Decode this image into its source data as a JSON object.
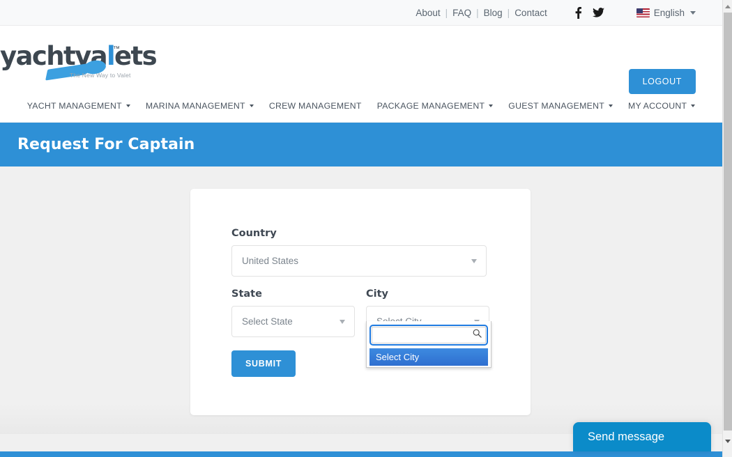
{
  "topbar": {
    "links": [
      {
        "label": "About"
      },
      {
        "label": "FAQ"
      },
      {
        "label": "Blog"
      },
      {
        "label": "Contact"
      }
    ],
    "separator": "|",
    "social": [
      {
        "name": "facebook-icon"
      },
      {
        "name": "twitter-icon"
      }
    ],
    "language": {
      "label": "English",
      "flag": "us-flag-icon"
    }
  },
  "header": {
    "logo": {
      "text_part1": "yacht",
      "text_part2": "va",
      "text_part3": "l",
      "text_part4": "ets",
      "trademark": "™",
      "tagline": "The New Way to Valet"
    },
    "logout_label": "LOGOUT"
  },
  "nav": {
    "items": [
      {
        "label": "YACHT MANAGEMENT",
        "has_caret": true
      },
      {
        "label": "MARINA MANAGEMENT",
        "has_caret": true
      },
      {
        "label": "CREW MANAGEMENT",
        "has_caret": false
      },
      {
        "label": "PACKAGE MANAGEMENT",
        "has_caret": true
      },
      {
        "label": "GUEST MANAGEMENT",
        "has_caret": true
      },
      {
        "label": "MY ACCOUNT",
        "has_caret": true
      }
    ]
  },
  "banner": {
    "title": "Request For Captain"
  },
  "form": {
    "country": {
      "label": "Country",
      "value": "United States"
    },
    "state": {
      "label": "State",
      "value": "Select State"
    },
    "city": {
      "label": "City",
      "value": "Select City",
      "dropdown_open": true,
      "search_value": "",
      "search_placeholder": "",
      "options": [
        {
          "label": "Select City",
          "selected": true
        }
      ]
    },
    "submit_label": "SUBMIT"
  },
  "chat": {
    "label": "Send message"
  },
  "colors": {
    "brand_blue": "#2e90d6",
    "chat_blue": "#0b8bc9",
    "option_blue": "#3d8ae0",
    "focus_ring": "#1f7ae0",
    "page_bg": "#f0f0f0",
    "text_dark": "#3f4853",
    "text_muted": "#7b848d"
  }
}
